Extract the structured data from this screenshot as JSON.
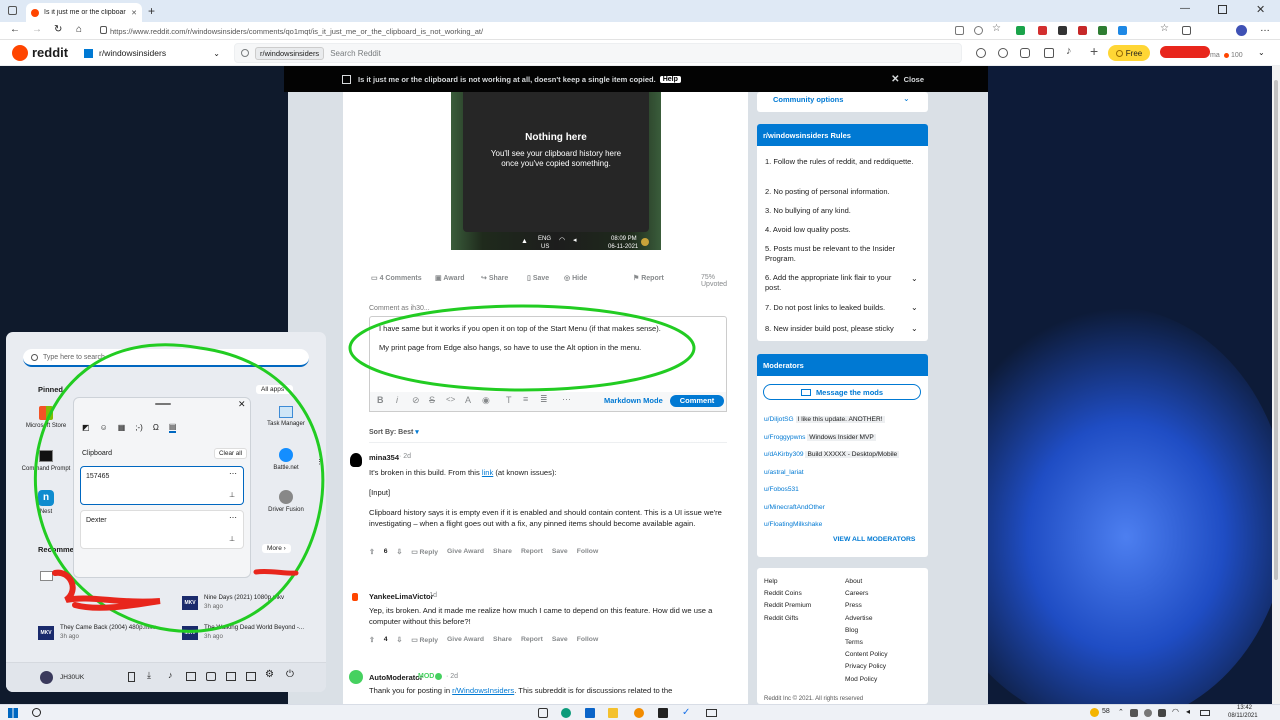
{
  "browser": {
    "tab_title": "Is it just me or the clipboard is not...",
    "url": "https://www.reddit.com/r/windowsinsiders/comments/qo1mqt/is_it_just_me_or_the_clipboard_is_not_working_at/"
  },
  "reddit": {
    "logo": "reddit",
    "community": "r/windowsinsiders",
    "search_chip": "r/windowsinsiders",
    "search_placeholder": "Search Reddit",
    "free_label": "Free",
    "user_name": "ma",
    "karma": "100",
    "banner_title": "Is it just me or the clipboard is not working at all, doesn't keep a single item copied.",
    "banner_flair": "Help",
    "close_label": "Close"
  },
  "post": {
    "image_title": "Nothing here",
    "image_text_1": "You'll see your clipboard history here",
    "image_text_2": "once you've copied something.",
    "image_lang": "ENG",
    "image_region": "US",
    "image_time": "08:09 PM",
    "image_date": "06-11-2021",
    "actions": {
      "comments": "4 Comments",
      "award": "Award",
      "share": "Share",
      "save": "Save",
      "hide": "Hide",
      "report": "Report",
      "upvoted": "75% Upvoted"
    },
    "comment_as": "Comment as ih30...",
    "draft_line_1": "I have same but it works if you open it on top of the Start Menu (if that makes sense).",
    "draft_line_2": "My print page from  Edge also hangs, so have to use the Alt option in the menu.",
    "markdown_mode": "Markdown Mode",
    "comment_button": "Comment",
    "sort_by": "Sort By: Best"
  },
  "comments": [
    {
      "user": "mina354",
      "age": "2d",
      "p1_before": "It's broken in this build. From this ",
      "p1_link": "link",
      "p1_after": " (at known issues):",
      "p2": "[Input]",
      "p3": "Clipboard history says it is empty even if it is enabled and should contain content. This is a UI issue we're investigating – when a flight goes out with a fix, any pinned items should become available again.",
      "votes": "6"
    },
    {
      "user": "YankeeLimaVictor",
      "age": "1d",
      "p1": "Yep, its broken. And it made me realize how much I came to depend on this feature. How did we use a computer without this before?!",
      "votes": "4"
    },
    {
      "user": "AutoModerator",
      "badge": "MOD",
      "age": "2d",
      "p1_before": "Thank you for posting in ",
      "p1_link": "r/WindowsInsiders",
      "p1_after": ". This subreddit is for discussions related to the"
    }
  ],
  "comment_actions": {
    "reply": "Reply",
    "give_award": "Give Award",
    "share": "Share",
    "report": "Report",
    "save": "Save",
    "follow": "Follow"
  },
  "sidebar": {
    "community_options": "Community options",
    "rules_title": "r/windowsinsiders Rules",
    "rules": [
      "1. Follow the rules of reddit, and reddiquette.",
      "2. No posting of personal information.",
      "3. No bullying of any kind.",
      "4. Avoid low quality posts.",
      "5. Posts must be relevant to the Insider Program.",
      "6. Add the appropriate link flair to your post.",
      "7. Do not post links to leaked builds.",
      "8. New insider build post, please sticky"
    ],
    "mods_title": "Moderators",
    "message_mods": "Message the mods",
    "mods": [
      {
        "name": "u/DiljotSG",
        "flair": "I like this update. ANOTHER!"
      },
      {
        "name": "u/Froggypwns",
        "flair": "Windows Insider MVP"
      },
      {
        "name": "u/dAKirby309",
        "flair": "Build XXXXX - Desktop/Mobile"
      },
      {
        "name": "u/astral_lariat",
        "flair": ""
      },
      {
        "name": "u/Fobos531",
        "flair": ""
      },
      {
        "name": "u/MinecraftAndOther",
        "flair": ""
      },
      {
        "name": "u/FloatingMilkshake",
        "flair": ""
      }
    ],
    "view_all": "VIEW ALL MODERATORS",
    "footer_left": [
      "Help",
      "Reddit Coins",
      "Reddit Premium",
      "Reddit Gifts"
    ],
    "footer_right": [
      "About",
      "Careers",
      "Press",
      "Advertise",
      "Blog",
      "Terms",
      "Content Policy",
      "Privacy Policy",
      "Mod Policy"
    ],
    "copyright": "Reddit Inc © 2021. All rights reserved"
  },
  "start": {
    "search_placeholder": "Type here to search",
    "pinned": "Pinned",
    "all_apps": "All apps",
    "apps": [
      "Microsoft Store",
      "Command Prompt",
      "Nest",
      "Task Manager",
      "Battle.net",
      "Driver Fusion"
    ],
    "recommended": "Recommended",
    "more": "More",
    "recent": [
      {
        "name": "Nine Days (2021) 1080p.mkv",
        "time": "3h ago"
      },
      {
        "name": "They Came Back (2004) 480p.mkv",
        "time": "3h ago"
      },
      {
        "name": "The Walking Dead World Beyond -...",
        "time": "3h ago"
      }
    ],
    "user": "JH30UK"
  },
  "clipboard": {
    "title": "Clipboard",
    "clear_all": "Clear all",
    "items": [
      "157465",
      "Dexter"
    ]
  },
  "taskbar": {
    "temp": "58",
    "time": "13:42",
    "date": "08/11/2021"
  },
  "colors": {
    "reddit_orange": "#ff4500",
    "reddit_blue": "#0079d3",
    "annotation_green": "#22cc22",
    "annotation_red": "#e8261c"
  }
}
